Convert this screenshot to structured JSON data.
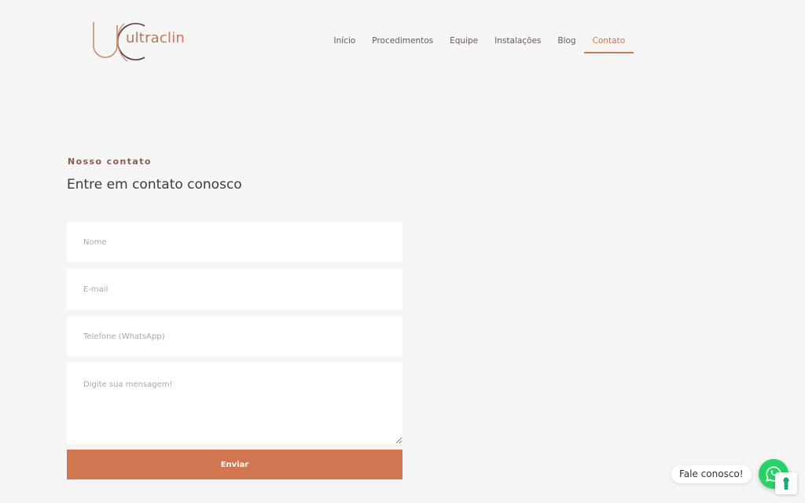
{
  "header": {
    "logo": {
      "text_ultra": "ultra",
      "text_clin": "clin"
    },
    "nav": [
      {
        "label": "Início",
        "active": false
      },
      {
        "label": "Procedimentos",
        "active": false
      },
      {
        "label": "Equipe",
        "active": false
      },
      {
        "label": "Instalações",
        "active": false
      },
      {
        "label": "Blog",
        "active": false
      },
      {
        "label": "Contato",
        "active": true
      }
    ]
  },
  "contact": {
    "eyebrow": "Nosso contato",
    "heading": "Entre em contato conosco",
    "form": {
      "name_placeholder": "Nome",
      "email_placeholder": "E-mail",
      "phone_placeholder": "Telefone (WhatsApp)",
      "message_placeholder": "Digite sua mensagem!",
      "submit_label": "Enviar"
    }
  },
  "chat_widget": {
    "label": "Fale conosco!",
    "icon": "whatsapp-icon"
  },
  "privacy_badge": {
    "icon": "keyhole-icon"
  },
  "colors": {
    "accent": "#d07650",
    "background": "#f5f5f5",
    "whatsapp": "#25d366"
  }
}
